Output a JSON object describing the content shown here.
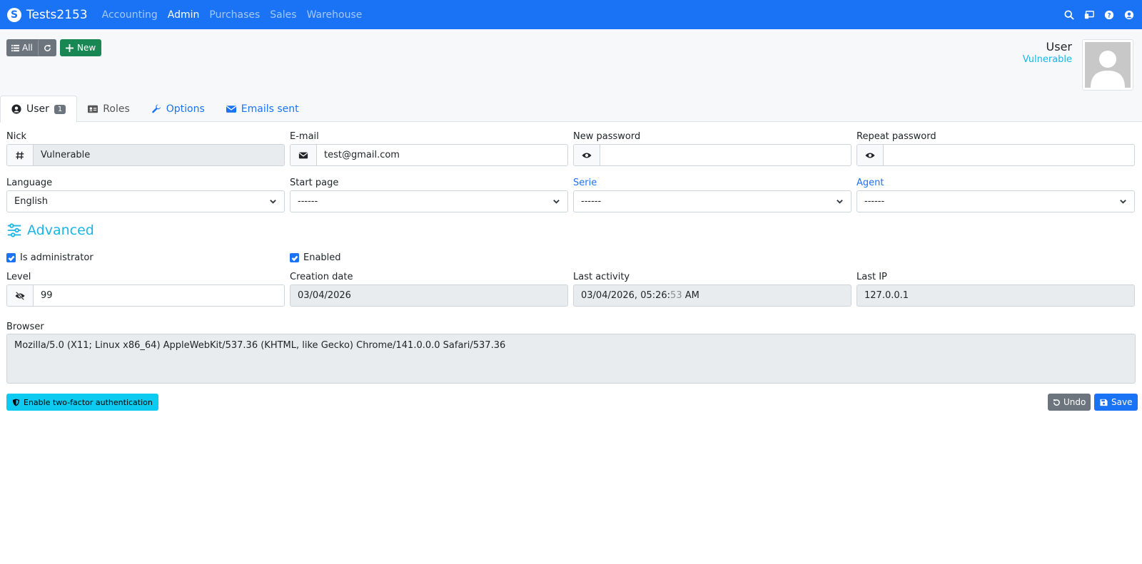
{
  "navbar": {
    "brand": "Tests2153",
    "brand_logo": "S",
    "links": [
      "Accounting",
      "Admin",
      "Purchases",
      "Sales",
      "Warehouse"
    ],
    "active_link": "Admin",
    "icons": [
      "search-icon",
      "display-icon",
      "help-icon",
      "user-circle-icon"
    ]
  },
  "toolbar": {
    "all_label": "All",
    "new_label": "New"
  },
  "header": {
    "title": "User",
    "subtitle": "Vulnerable"
  },
  "tabs": [
    {
      "label": "User",
      "badge": "1"
    },
    {
      "label": "Roles"
    },
    {
      "label": "Options"
    },
    {
      "label": "Emails sent"
    }
  ],
  "form": {
    "nick": {
      "label": "Nick",
      "value": "Vulnerable"
    },
    "email": {
      "label": "E-mail",
      "value": "test@gmail.com"
    },
    "new_password": {
      "label": "New password",
      "value": ""
    },
    "repeat_password": {
      "label": "Repeat password",
      "value": ""
    },
    "language": {
      "label": "Language",
      "value": "English"
    },
    "start_page": {
      "label": "Start page",
      "value": "------"
    },
    "serie": {
      "label": "Serie",
      "value": "------"
    },
    "agent": {
      "label": "Agent",
      "value": "------"
    }
  },
  "advanced": {
    "title": "Advanced",
    "is_admin": {
      "label": "Is administrator",
      "checked": true
    },
    "enabled": {
      "label": "Enabled",
      "checked": true
    },
    "level": {
      "label": "Level",
      "value": "99"
    },
    "creation_date": {
      "label": "Creation date",
      "value": "03/04/2026"
    },
    "last_activity": {
      "label": "Last activity",
      "value_main": "03/04/2026, 05:26:",
      "value_seconds": "53",
      "value_suffix": " AM"
    },
    "last_ip": {
      "label": "Last IP",
      "value": "127.0.0.1"
    },
    "browser": {
      "label": "Browser",
      "value": "Mozilla/5.0 (X11; Linux x86_64) AppleWebKit/537.36 (KHTML, like Gecko) Chrome/141.0.0.0 Safari/537.36"
    }
  },
  "actions": {
    "two_factor": "Enable two-factor authentication",
    "undo": "Undo",
    "save": "Save"
  },
  "colors": {
    "navbar": "#1a73f5",
    "accent": "#1bb5e6",
    "success": "#198754",
    "info": "#0dcaf0"
  }
}
